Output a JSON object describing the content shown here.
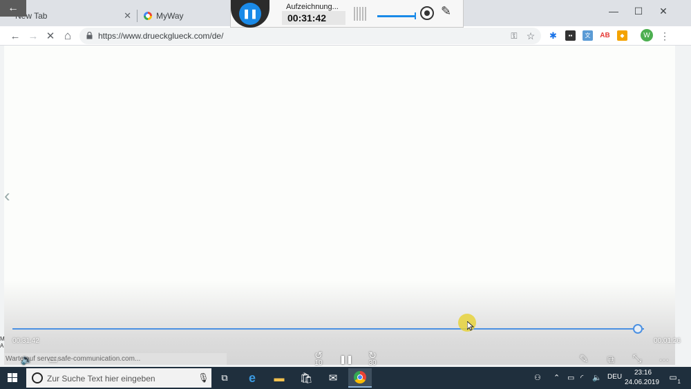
{
  "browser": {
    "tabs": [
      {
        "label": "New Tab",
        "close": "✕"
      },
      {
        "label": "MyWay"
      }
    ],
    "window_controls": {
      "minimize": "—",
      "maximize": "☐",
      "close": "✕"
    },
    "url": "https://www.drueckglueck.com/de/",
    "nav": {
      "back": "←",
      "forward": "→",
      "stop": "✕",
      "home": "⌂"
    },
    "extensions": [
      {
        "icon": "puzzle-icon",
        "color": "#1a73e8"
      },
      {
        "icon": "keyboard-icon",
        "color": "#333333"
      },
      {
        "icon": "translate-icon",
        "color": "#5b9bd5"
      },
      {
        "icon": "adblock-icon",
        "color": "#e53935"
      },
      {
        "icon": "shield-icon",
        "color": "#f4a300"
      }
    ],
    "profile_initial": "W",
    "profile_color": "#4caf50"
  },
  "recorder": {
    "status": "Aufzeichnung...",
    "elapsed": "00:31:42",
    "accent": "#1a8ae8"
  },
  "player": {
    "elapsed": "00:31:42",
    "total": "00:01:26",
    "progress": 0.99,
    "status_url": "Warte auf server.safe-communication.com...",
    "left_badge": "M\nA",
    "controls": {
      "volume": "🔈",
      "captions": "▭",
      "rewind": "10",
      "pause": "❚❚",
      "forward": "30",
      "edit": "✎",
      "miniplayer": "⧉",
      "exit_fullscreen": "⤡",
      "more": "···"
    }
  },
  "taskbar": {
    "search_placeholder": "Zur Suche Text hier eingeben",
    "language": "DEU",
    "time": "23:16",
    "date": "24.06.2019",
    "notification_count": "1"
  }
}
